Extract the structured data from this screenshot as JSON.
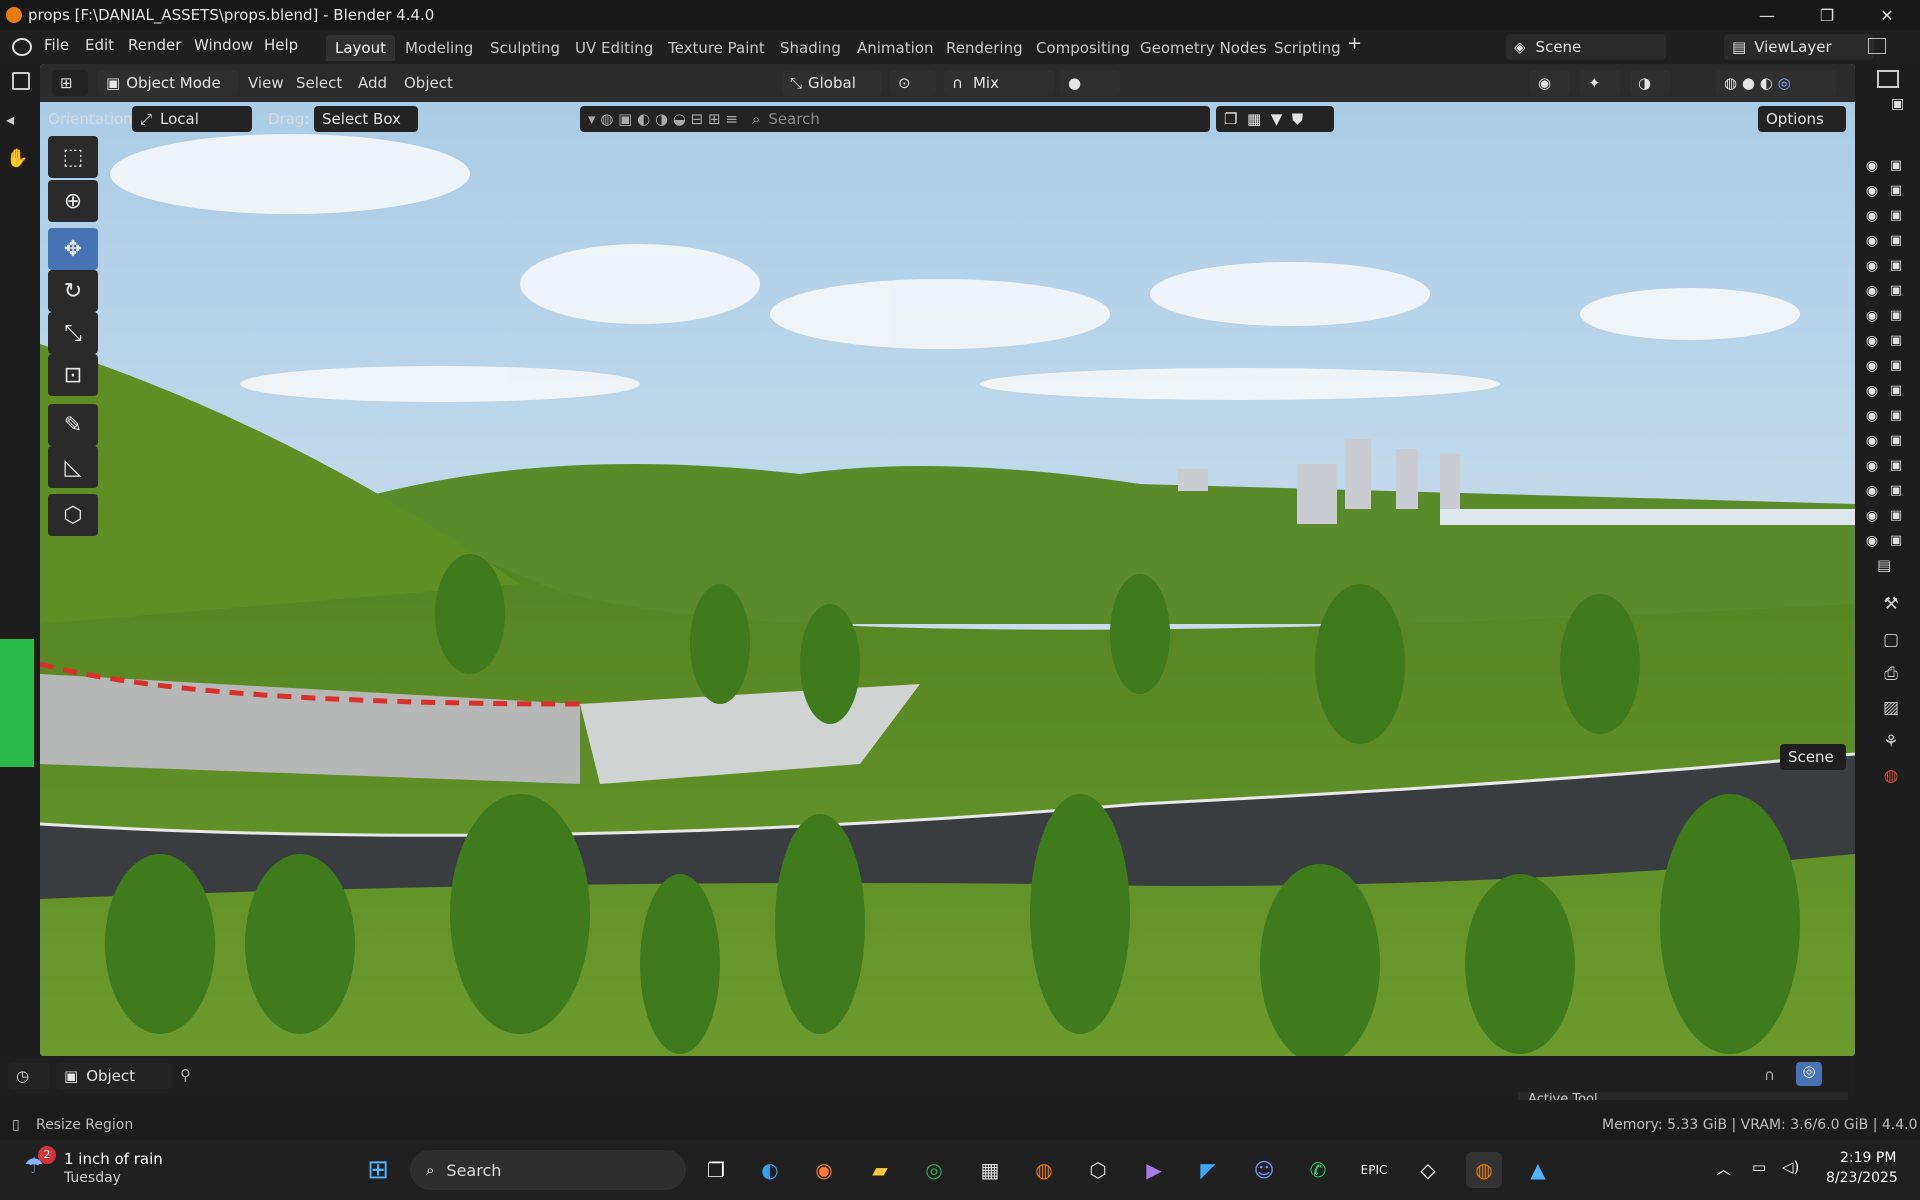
{
  "window": {
    "title": "props [F:\\DANIAL_ASSETS\\props.blend] - Blender 4.4.0",
    "minimize": "—",
    "restore": "❐",
    "close": "✕"
  },
  "menubar": {
    "items": [
      "File",
      "Edit",
      "Render",
      "Window",
      "Help"
    ],
    "workspace_tabs": [
      "Layout",
      "Modeling",
      "Sculpting",
      "UV Editing",
      "Texture Paint",
      "Shading",
      "Animation",
      "Rendering",
      "Compositing",
      "Geometry Nodes",
      "Scripting"
    ],
    "active_tab": "Layout",
    "add_tab": "+",
    "scene": "Scene",
    "view_layer": "ViewLayer"
  },
  "viewport_header": {
    "mode": "Object Mode",
    "menus": [
      "View",
      "Select",
      "Add",
      "Object"
    ],
    "transform_orientation": "Global",
    "snap_mix": "Mix",
    "orientation_label": "Orientation:",
    "orientation_value": "Local",
    "drag_label": "Drag:",
    "drag_value": "Select Box",
    "search_placeholder": "Search",
    "options": "Options"
  },
  "tooltip": "Scene",
  "timeline": {
    "editor_mode": "Object"
  },
  "statusbar": {
    "left": "Resize Region",
    "right": "Memory: 5.33 GiB | VRAM: 3.6/6.0 GiB | 4.4.0",
    "panel_label": "Active Tool"
  },
  "taskbar": {
    "weather_badge": "2",
    "weather_title": "1 inch of rain",
    "weather_day": "Tuesday",
    "search": "Search",
    "time": "2:19 PM",
    "date": "8/23/2025"
  },
  "colors": {
    "accent": "#4772b3",
    "blender_orange": "#e87d0d",
    "sky": "#b9d6e9",
    "grass": "#5f8f24"
  }
}
